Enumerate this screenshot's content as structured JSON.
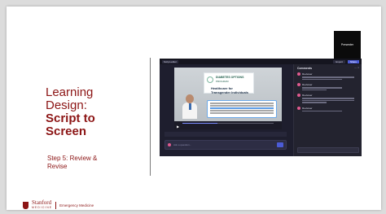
{
  "slide": {
    "title_line1": "Learning",
    "title_line2": "Design:",
    "title_line3": "Script to",
    "title_line4": "Screen",
    "subtitle_line1": "Step 5: Review &",
    "subtitle_line2": "Revise",
    "logo_brand": "Stanford",
    "logo_sub": "MEDICINE",
    "logo_dept": "Emergency Medicine"
  },
  "screenshot": {
    "corner_label": "Presenter",
    "top_tab": "Script editor",
    "top_button_primary": "Share",
    "top_button_secondary": "Export",
    "certificate_line1": "DIABETES OPTIONS",
    "certificate_line2": "PROGRAM",
    "certificate_line3": "Healthcare for Transgender Individuals",
    "prompt_placeholder": "Ask a question...",
    "sidebar_header": "Comments",
    "sidebar_icons": "⋯ ×",
    "sidebar_names": [
      "Reviewer",
      "Reviewer",
      "Reviewer",
      "Reviewer"
    ],
    "progress": 0.38
  },
  "colors": {
    "brand": "#8c1515",
    "accent": "#4b5bd6",
    "app_bg": "#1e1e2e"
  }
}
